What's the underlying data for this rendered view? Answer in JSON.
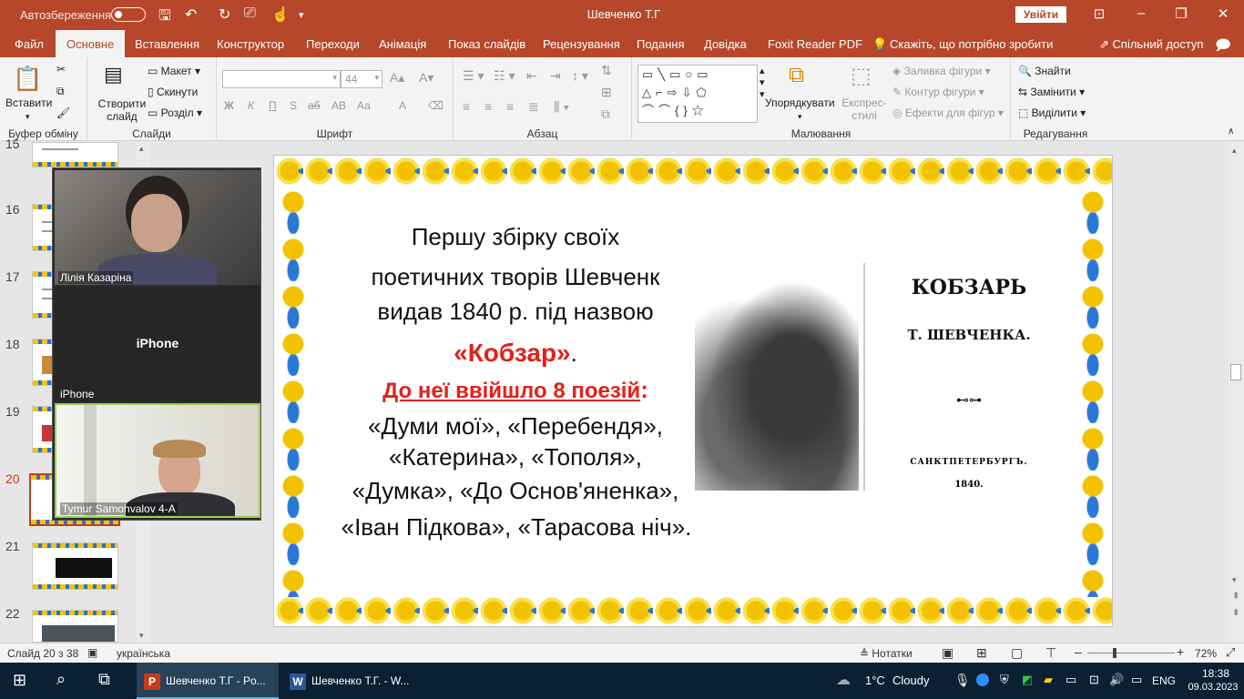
{
  "titlebar": {
    "autosave_label": "Автозбереження",
    "doc_title": "Шевченко Т.Г",
    "signin_label": "Увійти",
    "icons": [
      "save-icon",
      "undo-icon",
      "redo-icon",
      "present-icon",
      "touch-mode-icon",
      "customize-icon"
    ]
  },
  "tabs": [
    {
      "label": "Файл",
      "active": false
    },
    {
      "label": "Основне",
      "active": true
    },
    {
      "label": "Вставлення",
      "active": false
    },
    {
      "label": "Конструктор",
      "active": false
    },
    {
      "label": "Переходи",
      "active": false
    },
    {
      "label": "Анімація",
      "active": false
    },
    {
      "label": "Показ слайдів",
      "active": false
    },
    {
      "label": "Рецензування",
      "active": false
    },
    {
      "label": "Подання",
      "active": false
    },
    {
      "label": "Довідка",
      "active": false
    },
    {
      "label": "Foxit Reader PDF",
      "active": false
    },
    {
      "label": "Скажіть, що потрібно зробити",
      "active": false
    }
  ],
  "share_label": "Спільний доступ",
  "ribbon": {
    "clipboard": {
      "label": "Буфер обміну",
      "paste": "Вставити"
    },
    "slides": {
      "label": "Слайди",
      "new_slide": "Створити слайд",
      "layout": "Макет",
      "reset": "Скинути",
      "section": "Розділ"
    },
    "font": {
      "label": "Шрифт",
      "font_name": "",
      "font_size": "44",
      "buttons": [
        "Ж",
        "К",
        "П",
        "S",
        "аб",
        "АВ",
        "Аа",
        "A"
      ]
    },
    "paragraph": {
      "label": "Абзац"
    },
    "drawing": {
      "label": "Малювання",
      "arrange": "Упорядкувати",
      "quick_styles": "Експрес-стилі",
      "fill": "Заливка фігури",
      "outline": "Контур фігури",
      "effects": "Ефекти для фігур"
    },
    "editing": {
      "label": "Редагування",
      "find": "Знайти",
      "replace": "Замінити",
      "select": "Виділити"
    }
  },
  "thumbnails": [
    {
      "num": "15",
      "active": false
    },
    {
      "num": "16",
      "active": false
    },
    {
      "num": "17",
      "active": false
    },
    {
      "num": "18",
      "active": false
    },
    {
      "num": "19",
      "active": false
    },
    {
      "num": "20",
      "active": true
    },
    {
      "num": "21",
      "active": false
    },
    {
      "num": "22",
      "active": false
    }
  ],
  "video": {
    "participants": [
      {
        "name": "Лілія Казаріна",
        "label": ""
      },
      {
        "name": "iPhone",
        "label": "iPhone"
      },
      {
        "name": "Tymur Samohvalov 4-A",
        "label": ""
      }
    ]
  },
  "slide": {
    "lines": [
      "Першу збірку своїх",
      "поетичних творів Шевченк",
      "видав 1840 р. під назвою",
      "«Кобзар»",
      ".",
      "До неї ввійшло 8 поезій",
      ":",
      "«Думи мої», «Перебендя»,",
      "«Катерина», «Тополя»,",
      "«Думка», «До Основ'яненка»,",
      "«Іван Підкова», «Тарасова ніч»."
    ],
    "book": {
      "title": "КОБЗАРЬ",
      "author": "Т. ШЕВЧЕНКА.",
      "ornament": "⊷⊶",
      "city": "САНКТПЕТЕРБУРГЪ.",
      "year": "1840."
    }
  },
  "statusbar": {
    "slide_info": "Слайд 20 з 38",
    "language": "українська",
    "notes": "Нотатки",
    "zoom": "72%"
  },
  "taskbar": {
    "apps": [
      {
        "label": "Шевченко Т.Г - Po...",
        "icon": "P",
        "color": "#c43e1c",
        "active": true
      },
      {
        "label": "Шевченко Т.Г. - W...",
        "icon": "W",
        "color": "#2b5797",
        "active": false
      }
    ],
    "weather_temp": "1°C",
    "weather_text": "Cloudy",
    "lang": "ENG",
    "time": "18:38",
    "date": "09.03.2023"
  }
}
